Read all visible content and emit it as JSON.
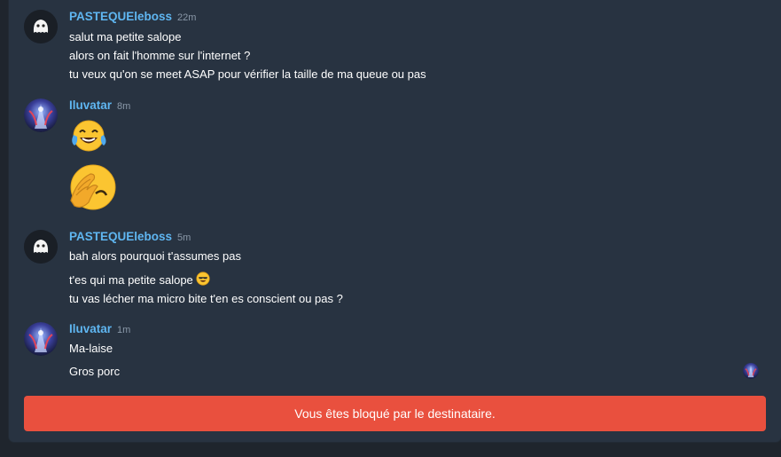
{
  "messages": [
    {
      "author": "PASTEQUEleboss",
      "time": "22m",
      "avatar": "ghost-avatar",
      "lines": [
        "salut ma petite salope",
        "alors on fait l'homme sur l'internet ?",
        "tu veux qu'on se meet ASAP pour vérifier la taille de ma queue ou pas"
      ]
    },
    {
      "author": "Iluvatar",
      "time": "8m",
      "avatar": "fantasy-art-avatar",
      "emojis": [
        "crying-laughing-emoji",
        "facepalm-emoji"
      ]
    },
    {
      "author": "PASTEQUEleboss",
      "time": "5m",
      "avatar": "ghost-avatar",
      "lines": [
        "bah alors pourquoi t'assumes pas",
        "t'es qui ma petite salope",
        "tu vas lécher ma micro bite t'en es conscient ou pas ?"
      ],
      "inline_emoji": "grinning-sunglasses-emoji"
    },
    {
      "author": "Iluvatar",
      "time": "1m",
      "avatar": "fantasy-art-avatar",
      "lines": [
        "Ma-laise",
        "Gros porc"
      ]
    }
  ],
  "blocked_banner": "Vous êtes bloqué par le destinataire.",
  "colors": {
    "author": "#5fb6f1",
    "banner": "#e9503e",
    "panel": "#283341",
    "background": "#1f252d"
  }
}
